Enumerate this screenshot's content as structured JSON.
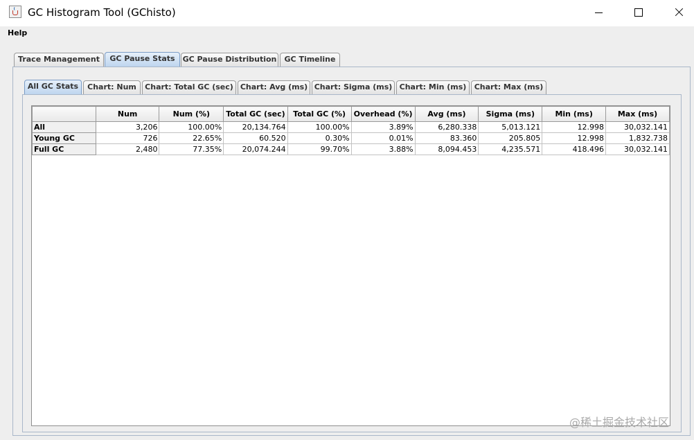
{
  "window": {
    "title": "GC Histogram Tool (GChisto)"
  },
  "menubar": {
    "items": [
      "Help"
    ]
  },
  "top_tabs": [
    {
      "label": "Trace Management",
      "selected": false
    },
    {
      "label": "GC Pause Stats",
      "selected": true
    },
    {
      "label": "GC Pause Distribution",
      "selected": false
    },
    {
      "label": "GC Timeline",
      "selected": false
    }
  ],
  "sub_tabs": [
    {
      "label": "All GC Stats",
      "selected": true
    },
    {
      "label": "Chart: Num",
      "selected": false
    },
    {
      "label": "Chart: Total GC (sec)",
      "selected": false
    },
    {
      "label": "Chart: Avg (ms)",
      "selected": false
    },
    {
      "label": "Chart: Sigma (ms)",
      "selected": false
    },
    {
      "label": "Chart: Min (ms)",
      "selected": false
    },
    {
      "label": "Chart: Max (ms)",
      "selected": false
    }
  ],
  "stats_table": {
    "columns": [
      "",
      "Num",
      "Num (%)",
      "Total GC (sec)",
      "Total GC (%)",
      "Overhead (%)",
      "Avg (ms)",
      "Sigma (ms)",
      "Min (ms)",
      "Max (ms)"
    ],
    "rows": [
      [
        "All",
        "3,206",
        "100.00%",
        "20,134.764",
        "100.00%",
        "3.89%",
        "6,280.338",
        "5,013.121",
        "12.998",
        "30,032.141"
      ],
      [
        "Young GC",
        "726",
        "22.65%",
        "60.520",
        "0.30%",
        "0.01%",
        "83.360",
        "205.805",
        "12.998",
        "1,832.738"
      ],
      [
        "Full GC",
        "2,480",
        "77.35%",
        "20,074.244",
        "99.70%",
        "3.88%",
        "8,094.453",
        "4,235.571",
        "418.496",
        "30,032.141"
      ]
    ]
  },
  "watermark": "@稀土掘金技术社区"
}
